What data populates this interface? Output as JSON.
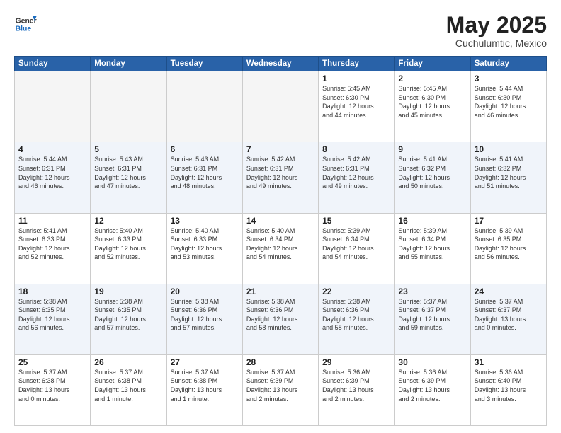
{
  "header": {
    "logo_general": "General",
    "logo_blue": "Blue",
    "title": "May 2025",
    "subtitle": "Cuchulumtic, Mexico"
  },
  "days_of_week": [
    "Sunday",
    "Monday",
    "Tuesday",
    "Wednesday",
    "Thursday",
    "Friday",
    "Saturday"
  ],
  "weeks": [
    [
      {
        "day": "",
        "empty": true
      },
      {
        "day": "",
        "empty": true
      },
      {
        "day": "",
        "empty": true
      },
      {
        "day": "",
        "empty": true
      },
      {
        "day": "1",
        "info": "Sunrise: 5:45 AM\nSunset: 6:30 PM\nDaylight: 12 hours\nand 44 minutes."
      },
      {
        "day": "2",
        "info": "Sunrise: 5:45 AM\nSunset: 6:30 PM\nDaylight: 12 hours\nand 45 minutes."
      },
      {
        "day": "3",
        "info": "Sunrise: 5:44 AM\nSunset: 6:30 PM\nDaylight: 12 hours\nand 46 minutes."
      }
    ],
    [
      {
        "day": "4",
        "info": "Sunrise: 5:44 AM\nSunset: 6:31 PM\nDaylight: 12 hours\nand 46 minutes."
      },
      {
        "day": "5",
        "info": "Sunrise: 5:43 AM\nSunset: 6:31 PM\nDaylight: 12 hours\nand 47 minutes."
      },
      {
        "day": "6",
        "info": "Sunrise: 5:43 AM\nSunset: 6:31 PM\nDaylight: 12 hours\nand 48 minutes."
      },
      {
        "day": "7",
        "info": "Sunrise: 5:42 AM\nSunset: 6:31 PM\nDaylight: 12 hours\nand 49 minutes."
      },
      {
        "day": "8",
        "info": "Sunrise: 5:42 AM\nSunset: 6:31 PM\nDaylight: 12 hours\nand 49 minutes."
      },
      {
        "day": "9",
        "info": "Sunrise: 5:41 AM\nSunset: 6:32 PM\nDaylight: 12 hours\nand 50 minutes."
      },
      {
        "day": "10",
        "info": "Sunrise: 5:41 AM\nSunset: 6:32 PM\nDaylight: 12 hours\nand 51 minutes."
      }
    ],
    [
      {
        "day": "11",
        "info": "Sunrise: 5:41 AM\nSunset: 6:33 PM\nDaylight: 12 hours\nand 52 minutes."
      },
      {
        "day": "12",
        "info": "Sunrise: 5:40 AM\nSunset: 6:33 PM\nDaylight: 12 hours\nand 52 minutes."
      },
      {
        "day": "13",
        "info": "Sunrise: 5:40 AM\nSunset: 6:33 PM\nDaylight: 12 hours\nand 53 minutes."
      },
      {
        "day": "14",
        "info": "Sunrise: 5:40 AM\nSunset: 6:34 PM\nDaylight: 12 hours\nand 54 minutes."
      },
      {
        "day": "15",
        "info": "Sunrise: 5:39 AM\nSunset: 6:34 PM\nDaylight: 12 hours\nand 54 minutes."
      },
      {
        "day": "16",
        "info": "Sunrise: 5:39 AM\nSunset: 6:34 PM\nDaylight: 12 hours\nand 55 minutes."
      },
      {
        "day": "17",
        "info": "Sunrise: 5:39 AM\nSunset: 6:35 PM\nDaylight: 12 hours\nand 56 minutes."
      }
    ],
    [
      {
        "day": "18",
        "info": "Sunrise: 5:38 AM\nSunset: 6:35 PM\nDaylight: 12 hours\nand 56 minutes."
      },
      {
        "day": "19",
        "info": "Sunrise: 5:38 AM\nSunset: 6:35 PM\nDaylight: 12 hours\nand 57 minutes."
      },
      {
        "day": "20",
        "info": "Sunrise: 5:38 AM\nSunset: 6:36 PM\nDaylight: 12 hours\nand 57 minutes."
      },
      {
        "day": "21",
        "info": "Sunrise: 5:38 AM\nSunset: 6:36 PM\nDaylight: 12 hours\nand 58 minutes."
      },
      {
        "day": "22",
        "info": "Sunrise: 5:38 AM\nSunset: 6:36 PM\nDaylight: 12 hours\nand 58 minutes."
      },
      {
        "day": "23",
        "info": "Sunrise: 5:37 AM\nSunset: 6:37 PM\nDaylight: 12 hours\nand 59 minutes."
      },
      {
        "day": "24",
        "info": "Sunrise: 5:37 AM\nSunset: 6:37 PM\nDaylight: 13 hours\nand 0 minutes."
      }
    ],
    [
      {
        "day": "25",
        "info": "Sunrise: 5:37 AM\nSunset: 6:38 PM\nDaylight: 13 hours\nand 0 minutes."
      },
      {
        "day": "26",
        "info": "Sunrise: 5:37 AM\nSunset: 6:38 PM\nDaylight: 13 hours\nand 1 minute."
      },
      {
        "day": "27",
        "info": "Sunrise: 5:37 AM\nSunset: 6:38 PM\nDaylight: 13 hours\nand 1 minute."
      },
      {
        "day": "28",
        "info": "Sunrise: 5:37 AM\nSunset: 6:39 PM\nDaylight: 13 hours\nand 2 minutes."
      },
      {
        "day": "29",
        "info": "Sunrise: 5:36 AM\nSunset: 6:39 PM\nDaylight: 13 hours\nand 2 minutes."
      },
      {
        "day": "30",
        "info": "Sunrise: 5:36 AM\nSunset: 6:39 PM\nDaylight: 13 hours\nand 2 minutes."
      },
      {
        "day": "31",
        "info": "Sunrise: 5:36 AM\nSunset: 6:40 PM\nDaylight: 13 hours\nand 3 minutes."
      }
    ]
  ],
  "row_classes": [
    "row-week1",
    "row-week2",
    "row-week3",
    "row-week4",
    "row-week5"
  ]
}
